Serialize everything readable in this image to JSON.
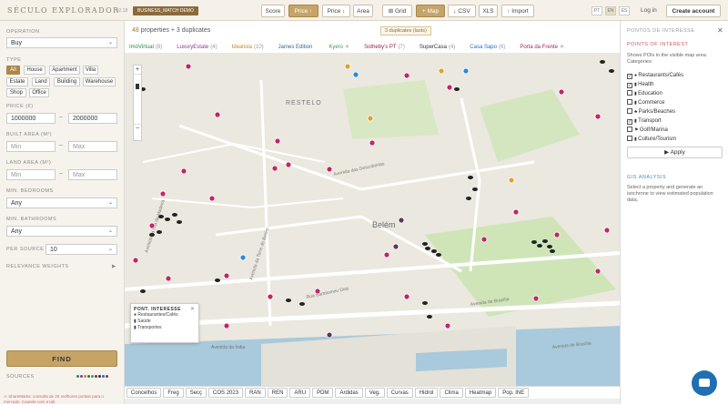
{
  "app": {
    "logo": "SÉCULO EXPLORADOR",
    "version": "v2.18",
    "badge": "BUSINESS_MATCH DEMO"
  },
  "toolbar": {
    "score": "Score",
    "price_up": "Price ↑",
    "price_down": "Price ↓",
    "area": "Area",
    "grid": "⊞ Grid",
    "map": "+ Map",
    "csv": "↓ CSV",
    "xls": "XLS",
    "import": "↑ Import"
  },
  "lang": {
    "pt": "PT",
    "en": "EN",
    "es": "ES"
  },
  "auth": {
    "login": "Log in",
    "create": "Create account"
  },
  "filters": {
    "operation_label": "OPERATION",
    "operation": "Buy",
    "type_label": "TYPE",
    "types": [
      "All",
      "House",
      "Apartment",
      "Villa",
      "Estate",
      "Land",
      "Building",
      "Warehouse",
      "Shop",
      "Office"
    ],
    "price_label": "PRICE (€)",
    "price_min": "1000000",
    "price_max": "2000000",
    "built_label": "BUILT AREA (M²)",
    "built_min": "Min",
    "built_max": "Max",
    "land_label": "LAND AREA (M²)",
    "land_min": "Min",
    "land_max": "Max",
    "bed_label": "MIN. BEDROOMS",
    "bed": "Any",
    "bath_label": "MIN. BATHROOMS",
    "bath": "Any",
    "per_source_label": "PER SOURCE",
    "per_source": "10",
    "relevance_label": "RELEVANCE WEIGHTS",
    "find": "FIND",
    "sources_label": "SOURCES",
    "footnote": "⚠ ShareMarks: consulta de 20 melhores portais para o mercado. Cautela com a tab"
  },
  "results": {
    "count": "48",
    "count_text": "properties + 3 duplicates",
    "dup_badge": "3 duplicates (lasts)"
  },
  "sources": [
    {
      "name": "ImóVirtual",
      "n": "(8)",
      "color": "#2b8a4a"
    },
    {
      "name": "LuxuryEstate",
      "n": "(4)",
      "color": "#8a3a8a"
    },
    {
      "name": "Idealista",
      "n": "(10)",
      "color": "#c68a2a"
    },
    {
      "name": "James Edition",
      "n": "",
      "color": "#2b6a8a"
    },
    {
      "name": "Kyero",
      "n": "✕",
      "color": "#4a9a4a"
    },
    {
      "name": "Sotheby's PT",
      "n": "(7)",
      "color": "#8a2a3a"
    },
    {
      "name": "SuperCasa",
      "n": "(4)",
      "color": "#333"
    },
    {
      "name": "Casa Sapo",
      "n": "(6)",
      "color": "#2a6ac6"
    },
    {
      "name": "Porta da Frente",
      "n": "✕",
      "color": "#9a2a5a"
    }
  ],
  "map": {
    "places": [
      "RESTELO",
      "Belém"
    ],
    "streets": [
      "Avenida da Índia",
      "Avenida de Brasília",
      "Avenida da Torre de Belém",
      "Rua Bartolomeu Dias",
      "Avenida das Descobertas",
      "Avenida da Ilha da Madeira",
      "Avenida de Brasília"
    ]
  },
  "legend": {
    "title": "PONT. INTERESSE",
    "items": [
      "● Restaurantes/Cafés",
      "▮ Saúde",
      "▮ Transportes"
    ]
  },
  "bottom_tabs": [
    "Concelhos",
    "Freg",
    "Secç",
    "COS 2023",
    "RAN",
    "REN",
    "ARU",
    "PDM",
    "Ardidas",
    "Veg.",
    "Curvas",
    "Hidrol",
    "Clima",
    "Heatmap",
    "Pop. INE"
  ],
  "poi_panel": {
    "header": "PONTOS DE INTERESSE",
    "title": "POINTS OF INTEREST",
    "desc": "Shows POIs in the visible map area. Categories:",
    "categories": [
      {
        "label": "Restaurants/Cafés",
        "checked": true
      },
      {
        "label": "Health",
        "checked": true
      },
      {
        "label": "Education",
        "checked": false
      },
      {
        "label": "Commerce",
        "checked": false
      },
      {
        "label": "Parks/Beaches",
        "checked": false
      },
      {
        "label": "Transport",
        "checked": true
      },
      {
        "label": "Golf/Marina",
        "checked": false
      },
      {
        "label": "Culture/Tourism",
        "checked": false
      }
    ],
    "apply": "▶ Apply",
    "gis_title": "GIS ANALYSIS",
    "gis_desc": "Select a property and generate an isochrone to view estimated population data."
  }
}
